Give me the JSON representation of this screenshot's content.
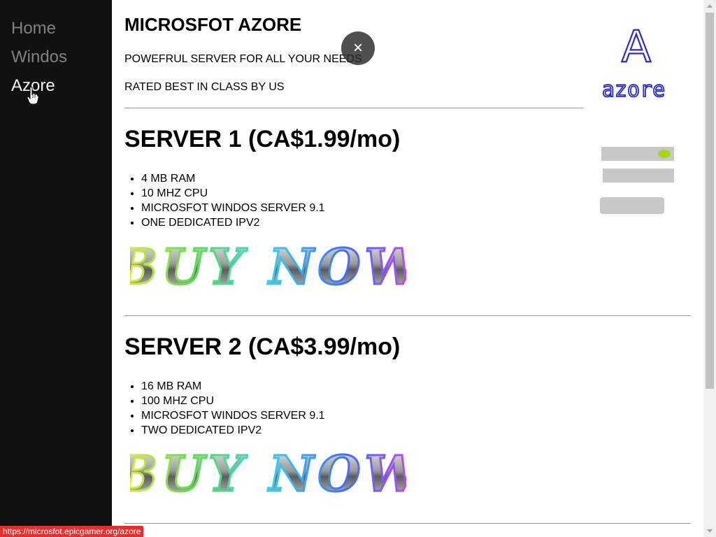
{
  "sidebar": {
    "items": [
      {
        "label": "Home"
      },
      {
        "label": "Windos"
      },
      {
        "label": "Azore"
      }
    ]
  },
  "header": {
    "title": "MICROSFOT AZORE",
    "tagline1": "POWEFRUL SERVER FOR ALL YOUR NEEDS",
    "tagline2": "RATED BEST IN CLASS BY US"
  },
  "logo": {
    "letter": "A",
    "text": "azore"
  },
  "servers": [
    {
      "title": "SERVER 1 (CA$1.99/mo)",
      "features": [
        "4 MB RAM",
        "10 MHZ CPU",
        "MICROSFOT WINDOS SERVER 9.1",
        "ONE DEDICATED IPV2"
      ],
      "buy_label": "BUY NOW"
    },
    {
      "title": "SERVER 2 (CA$3.99/mo)",
      "features": [
        "16 MB RAM",
        "100 MHZ CPU",
        "MICROSFOT WINDOS SERVER 9.1",
        "TWO DEDICATED IPV2"
      ],
      "buy_label": "BUY NOW"
    }
  ],
  "overlay": {
    "close_symbol": "×"
  },
  "status_bar": {
    "url": "https://microsfot.epicgamer.org/azore"
  },
  "icons": {
    "close": "close-icon",
    "cursor": "hand-pointer-icon",
    "logo": "azore-logo"
  },
  "colors": {
    "sidebar_bg": "#111111",
    "nav_inactive": "#818181",
    "nav_active": "#f1f1f1",
    "status_bar_bg": "#e03030"
  }
}
